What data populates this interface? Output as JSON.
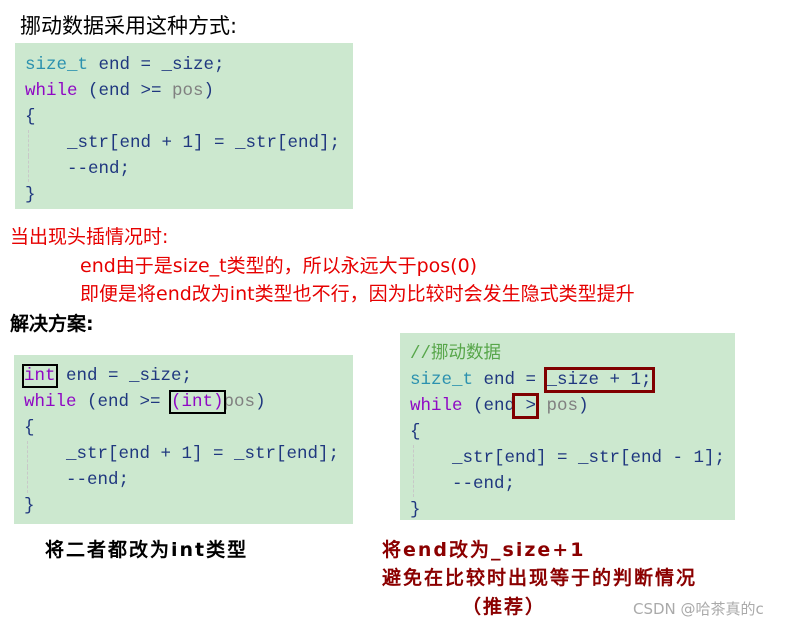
{
  "heading1": "挪动数据采用这种方式:",
  "code1": [
    [
      {
        "t": "size_t",
        "c": "type"
      },
      {
        "t": " end = _size;",
        "c": "var"
      }
    ],
    [
      {
        "t": "while",
        "c": "kw"
      },
      {
        "t": " (end >= ",
        "c": "var"
      },
      {
        "t": "pos",
        "c": "gray"
      },
      {
        "t": ")",
        "c": "var"
      }
    ],
    [
      {
        "t": "{",
        "c": "var"
      }
    ],
    [
      {
        "t": "_str[end + 1] = _str[end];",
        "c": "var",
        "indent": true
      }
    ],
    [
      {
        "t": "--end;",
        "c": "var",
        "indent": true
      }
    ],
    [
      {
        "t": "}",
        "c": "var"
      }
    ]
  ],
  "note": {
    "title": "当出现头插情况时:",
    "line1": "end由于是size_t类型的，所以永远大于pos(0)",
    "line2": "即便是将end改为int类型也不行，因为比较时会发生隐式类型提升"
  },
  "heading2": "解决方案:",
  "code2": [
    [
      {
        "t": "int",
        "c": "kw",
        "box": "b"
      },
      {
        "t": " end = _size;",
        "c": "var"
      }
    ],
    [
      {
        "t": "while",
        "c": "kw"
      },
      {
        "t": " (end >= ",
        "c": "var"
      },
      {
        "t": "(int)",
        "c": "kw",
        "box": "b"
      },
      {
        "t": "pos",
        "c": "gray"
      },
      {
        "t": ")",
        "c": "var"
      }
    ],
    [
      {
        "t": "{",
        "c": "var"
      }
    ],
    [
      {
        "t": "_str[end + 1] = _str[end];",
        "c": "var",
        "indent": true
      }
    ],
    [
      {
        "t": "--end;",
        "c": "var",
        "indent": true
      }
    ],
    [
      {
        "t": "}",
        "c": "var"
      }
    ]
  ],
  "code3": [
    [
      {
        "t": "//挪动数据",
        "c": "cm"
      }
    ],
    [
      {
        "t": "size_t",
        "c": "type"
      },
      {
        "t": " end = ",
        "c": "var"
      },
      {
        "t": "_size + 1;",
        "c": "var",
        "box": "r"
      }
    ],
    [
      {
        "t": "while",
        "c": "kw"
      },
      {
        "t": " (end",
        "c": "var"
      },
      {
        "t": " >",
        "c": "var",
        "box": "r"
      },
      {
        "t": " pos",
        "c": "gray"
      },
      {
        "t": ")",
        "c": "var"
      }
    ],
    [
      {
        "t": "{",
        "c": "var"
      }
    ],
    [
      {
        "t": "_str[end] = _str[end - 1];",
        "c": "var",
        "indent": true
      }
    ],
    [
      {
        "t": "--end;",
        "c": "var",
        "indent": true
      }
    ],
    [
      {
        "t": "}",
        "c": "var"
      }
    ]
  ],
  "caption_left": "将二者都改为int类型",
  "caption_right": {
    "line1": "将end改为_size+1",
    "line2": "避免在比较时出现等于的判断情况",
    "line3": "（推荐）"
  },
  "watermark": "CSDN @哈茶真的c"
}
